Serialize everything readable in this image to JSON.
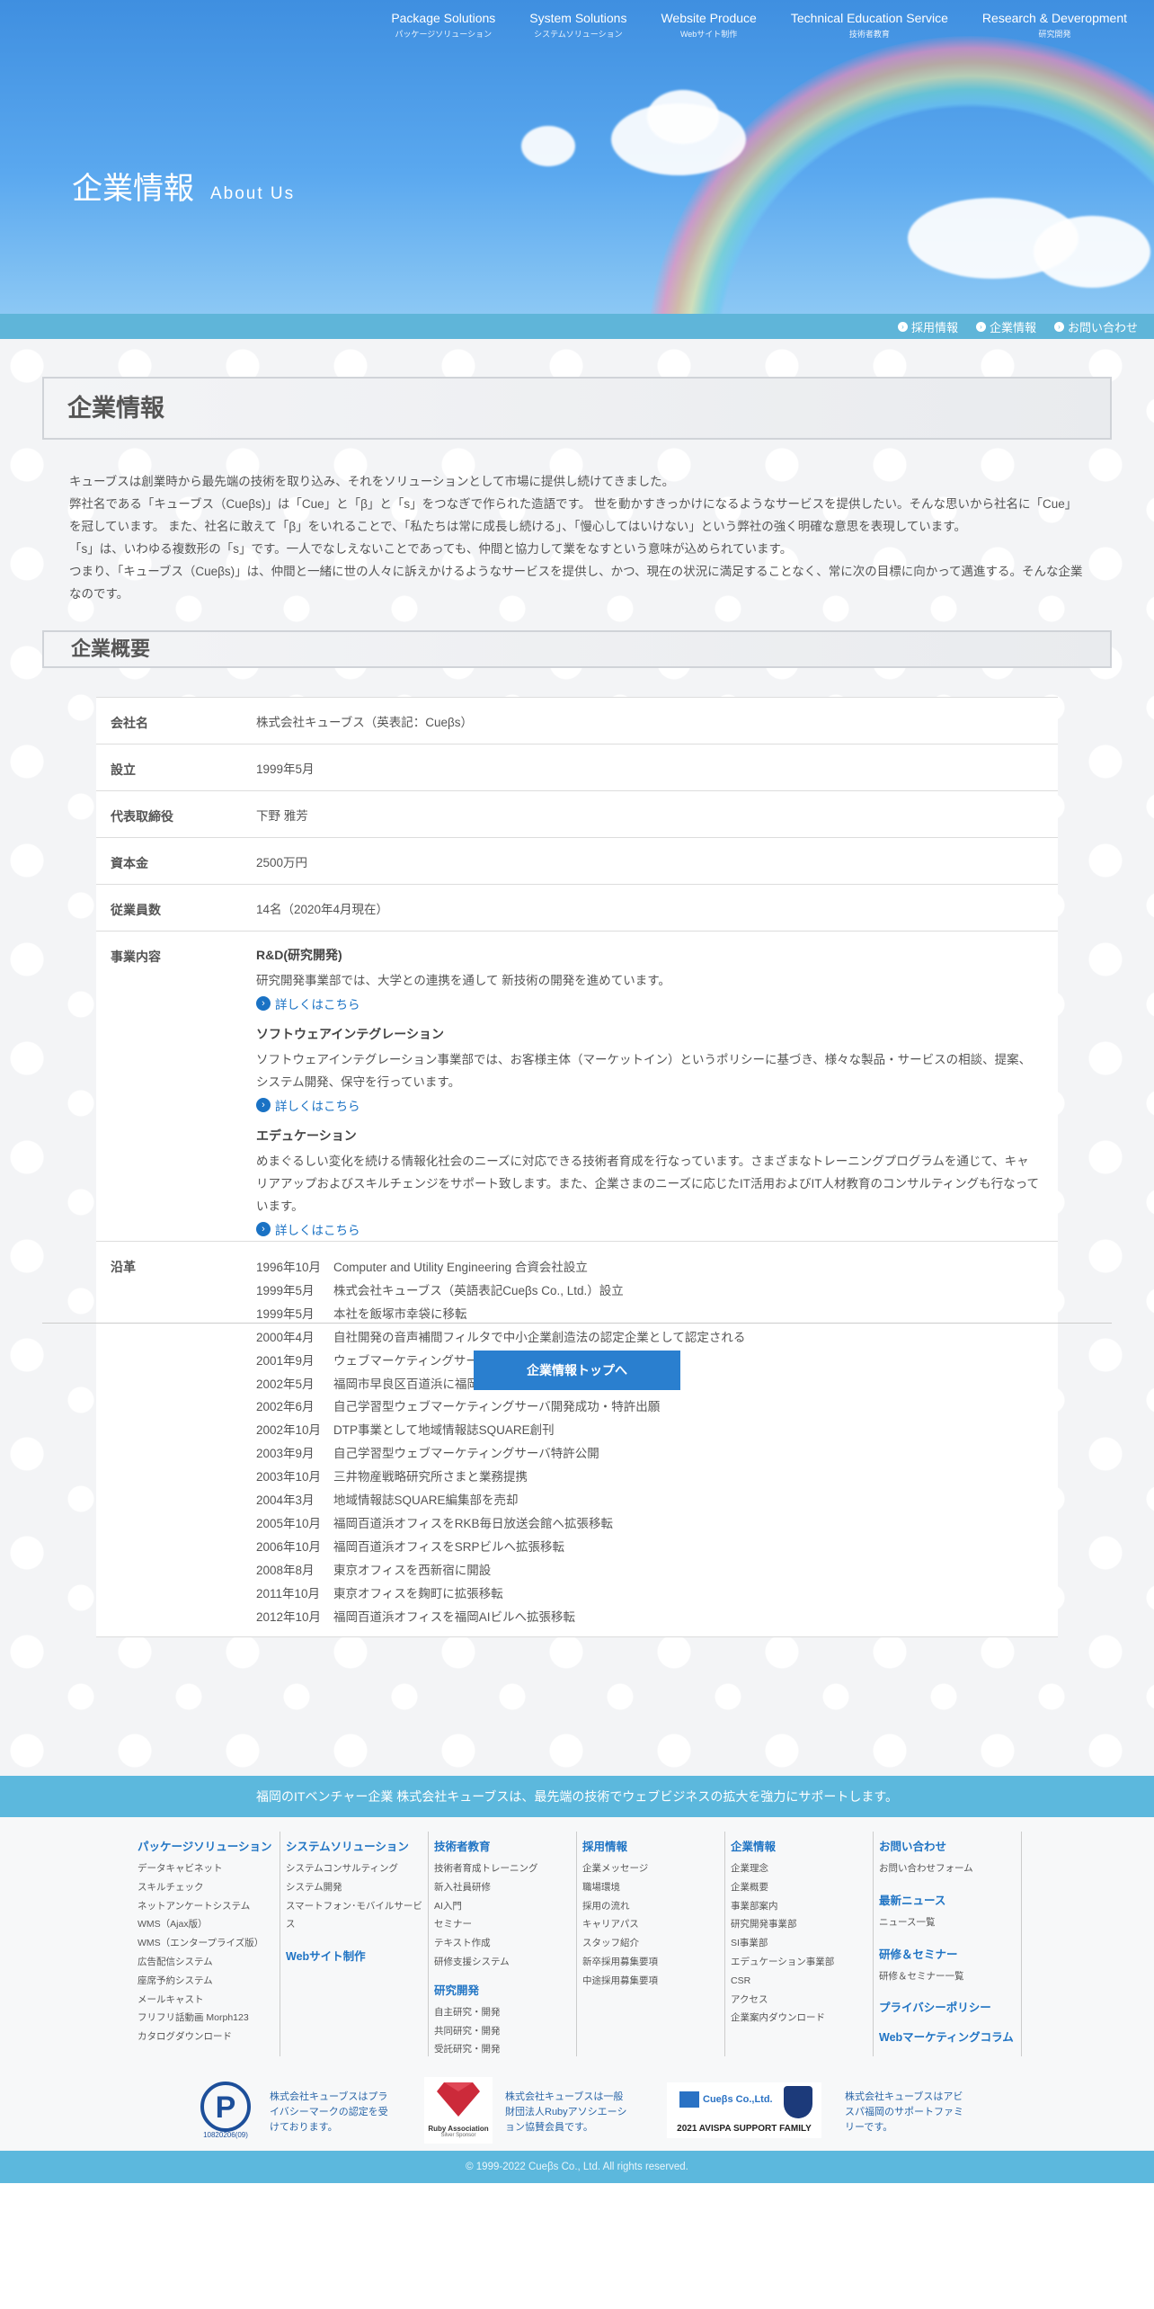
{
  "topnav": [
    {
      "en": "Package Solutions",
      "ja": "パッケージソリューション"
    },
    {
      "en": "System Solutions",
      "ja": "システムソリューション"
    },
    {
      "en": "Website Produce",
      "ja": "Webサイト制作"
    },
    {
      "en": "Technical Education Service",
      "ja": "技術者教育"
    },
    {
      "en": "Research & Deveropment",
      "ja": "研究開発"
    }
  ],
  "hero": {
    "title_ja": "企業情報",
    "title_en": "About Us"
  },
  "subnav": [
    {
      "label": "採用情報"
    },
    {
      "label": "企業情報"
    },
    {
      "label": "お問い合わせ"
    }
  ],
  "section1": {
    "title": "企業情報"
  },
  "intro": [
    "キューブスは創業時から最先端の技術を取り込み、それをソリューションとして市場に提供し続けてきました。",
    "弊社名である「キューブス（Cueβs)」は「Cue」と「β」と「s」をつなぎで作られた造語です。 世を動かすきっかけになるようなサービスを提供したい。そんな思いから社名に「Cue」を冠しています。 また、社名に敢えて「β」をいれることで、「私たちは常に成長し続ける」、「慢心してはいけない」という弊社の強く明確な意思を表現しています。",
    "「s」は、いわゆる複数形の「s」です。一人でなしえないことであっても、仲間と協力して業をなすという意味が込められています。",
    "つまり、「キューブス（Cueβs)」は、仲間と一緒に世の人々に訴えかけるようなサービスを提供し、かつ、現在の状況に満足することなく、常に次の目標に向かって邁進する。そんな企業なのです。"
  ],
  "section2": {
    "title": "企業概要"
  },
  "overview": {
    "company_label": "会社名",
    "company": "株式会社キューブス（英表記：Cueβs）",
    "founded_label": "設立",
    "founded": "1999年5月",
    "ceo_label": "代表取締役",
    "ceo": "下野 雅芳",
    "capital_label": "資本金",
    "capital": "2500万円",
    "employees_label": "従業員数",
    "employees": "14名（2020年4月現在）",
    "business_label": "事業内容",
    "history_label": "沿革"
  },
  "business": [
    {
      "title": "R&D(研究開発)",
      "desc": "研究開発事業部では、大学との連携を通して 新技術の開発を進めています。",
      "link": "詳しくはこちら"
    },
    {
      "title": "ソフトウェアインテグレーション",
      "desc": "ソフトウェアインテグレーション事業部では、お客様主体（マーケットイン）というポリシーに基づき、様々な製品・サービスの相談、提案、システム開発、保守を行っています。",
      "link": "詳しくはこちら"
    },
    {
      "title": "エデュケーション",
      "desc": "めまぐるしい変化を続ける情報化社会のニーズに対応できる技術者育成を行なっています。さまざまなトレーニングプログラムを通じて、キャリアアップおよびスキルチェンジをサポート致します。また、企業さまのニーズに応じたIT活用およびIT人材教育のコンサルティングも行なっています。",
      "link": "詳しくはこちら"
    }
  ],
  "history": [
    {
      "date": "1996年10月",
      "event": "Computer and Utility Engineering 合資会社設立"
    },
    {
      "date": "1999年5月",
      "event": "株式会社キューブス（英語表記Cueβs Co., Ltd.）設立"
    },
    {
      "date": "1999年5月",
      "event": "本社を飯塚市幸袋に移転"
    },
    {
      "date": "2000年4月",
      "event": "自社開発の音声補間フィルタで中小企業創造法の認定企業として認定される"
    },
    {
      "date": "2001年9月",
      "event": "ウェブマーケティングサーバの開発に着手"
    },
    {
      "date": "2002年5月",
      "event": "福岡市早良区百道浜に福岡百道浜オフィス開設"
    },
    {
      "date": "2002年6月",
      "event": "自己学習型ウェブマーケティングサーバ開発成功・特許出願"
    },
    {
      "date": "2002年10月",
      "event": "DTP事業として地域情報誌SQUARE創刊"
    },
    {
      "date": "2003年9月",
      "event": "自己学習型ウェブマーケティングサーバ特許公開"
    },
    {
      "date": "2003年10月",
      "event": "三井物産戦略研究所さまと業務提携"
    },
    {
      "date": "2004年3月",
      "event": "地域情報誌SQUARE編集部を売却"
    },
    {
      "date": "2005年10月",
      "event": "福岡百道浜オフィスをRKB毎日放送会館へ拡張移転"
    },
    {
      "date": "2006年10月",
      "event": "福岡百道浜オフィスをSRPビルへ拡張移転"
    },
    {
      "date": "2008年8月",
      "event": "東京オフィスを西新宿に開設"
    },
    {
      "date": "2011年10月",
      "event": "東京オフィスを麹町に拡張移転"
    },
    {
      "date": "2012年10月",
      "event": "福岡百道浜オフィスを福岡AIビルへ拡張移転"
    }
  ],
  "top_button": "企業情報トップへ",
  "footer_tagline": "福岡のITベンチャー企業 株式会社キューブスは、最先端の技術でウェブビジネスの拡大を強力にサポートします。",
  "sitemap": {
    "col1": {
      "head": "パッケージソリューション",
      "links": [
        "データキャビネット",
        "スキルチェック",
        "ネットアンケートシステム",
        "WMS（Ajax版）",
        "WMS（エンタープライズ版）",
        "広告配信システム",
        "座席予約システム",
        "メールキャスト",
        "フリフリ話動画 Morph123",
        "カタログダウンロード"
      ]
    },
    "col2": {
      "head": "システムソリューション",
      "links": [
        "システムコンサルティング",
        "システム開発",
        "スマートフォン･モバイルサービス"
      ],
      "head2": "Webサイト制作"
    },
    "col3": {
      "head": "技術者教育",
      "links": [
        "技術者育成トレーニング",
        "新入社員研修",
        "AI入門",
        "セミナー",
        "テキスト作成",
        "研修支援システム"
      ],
      "head2": "研究開発",
      "links2": [
        "自主研究・開発",
        "共同研究・開発",
        "受託研究・開発"
      ]
    },
    "col4": {
      "head": "採用情報",
      "links": [
        "企業メッセージ",
        "職場環境",
        "採用の流れ",
        "キャリアパス",
        "スタッフ紹介",
        "新卒採用募集要項",
        "中途採用募集要項"
      ]
    },
    "col5": {
      "head": "企業情報",
      "links": [
        "企業理念",
        "企業概要",
        "事業部案内",
        "研究開発事業部",
        "SI事業部",
        "エデュケーション事業部",
        "CSR",
        "アクセス",
        "企業案内ダウンロード"
      ]
    },
    "col6": {
      "head": "お問い合わせ",
      "links": [
        "お問い合わせフォーム"
      ],
      "head2": "最新ニュース",
      "links2": [
        "ニュース一覧"
      ],
      "head3": "研修＆セミナー",
      "links3": [
        "研修＆セミナー一覧"
      ],
      "head4": "プライバシーポリシー",
      "head5": "Webマーケティングコラム"
    }
  },
  "badges": {
    "privacy_text": "株式会社キューブスはプライバシーマークの認定を受けております。",
    "privacy_num": "10820206(09)",
    "ruby_text": "株式会社キューブスは一般財団法人Rubyアソシエーション協賛会員です。",
    "ruby_label": "Ruby Association",
    "ruby_sub": "Silver Sponsor",
    "avispa_text": "株式会社キューブスはアビスパ福岡のサポートファミリーです。",
    "avispa_label": "2021 AVISPA SUPPORT FAMILY",
    "cuebs_logo": "Cueβs Co.,Ltd."
  },
  "copyright": "© 1999-2022 Cueβs Co., Ltd. All rights reserved."
}
